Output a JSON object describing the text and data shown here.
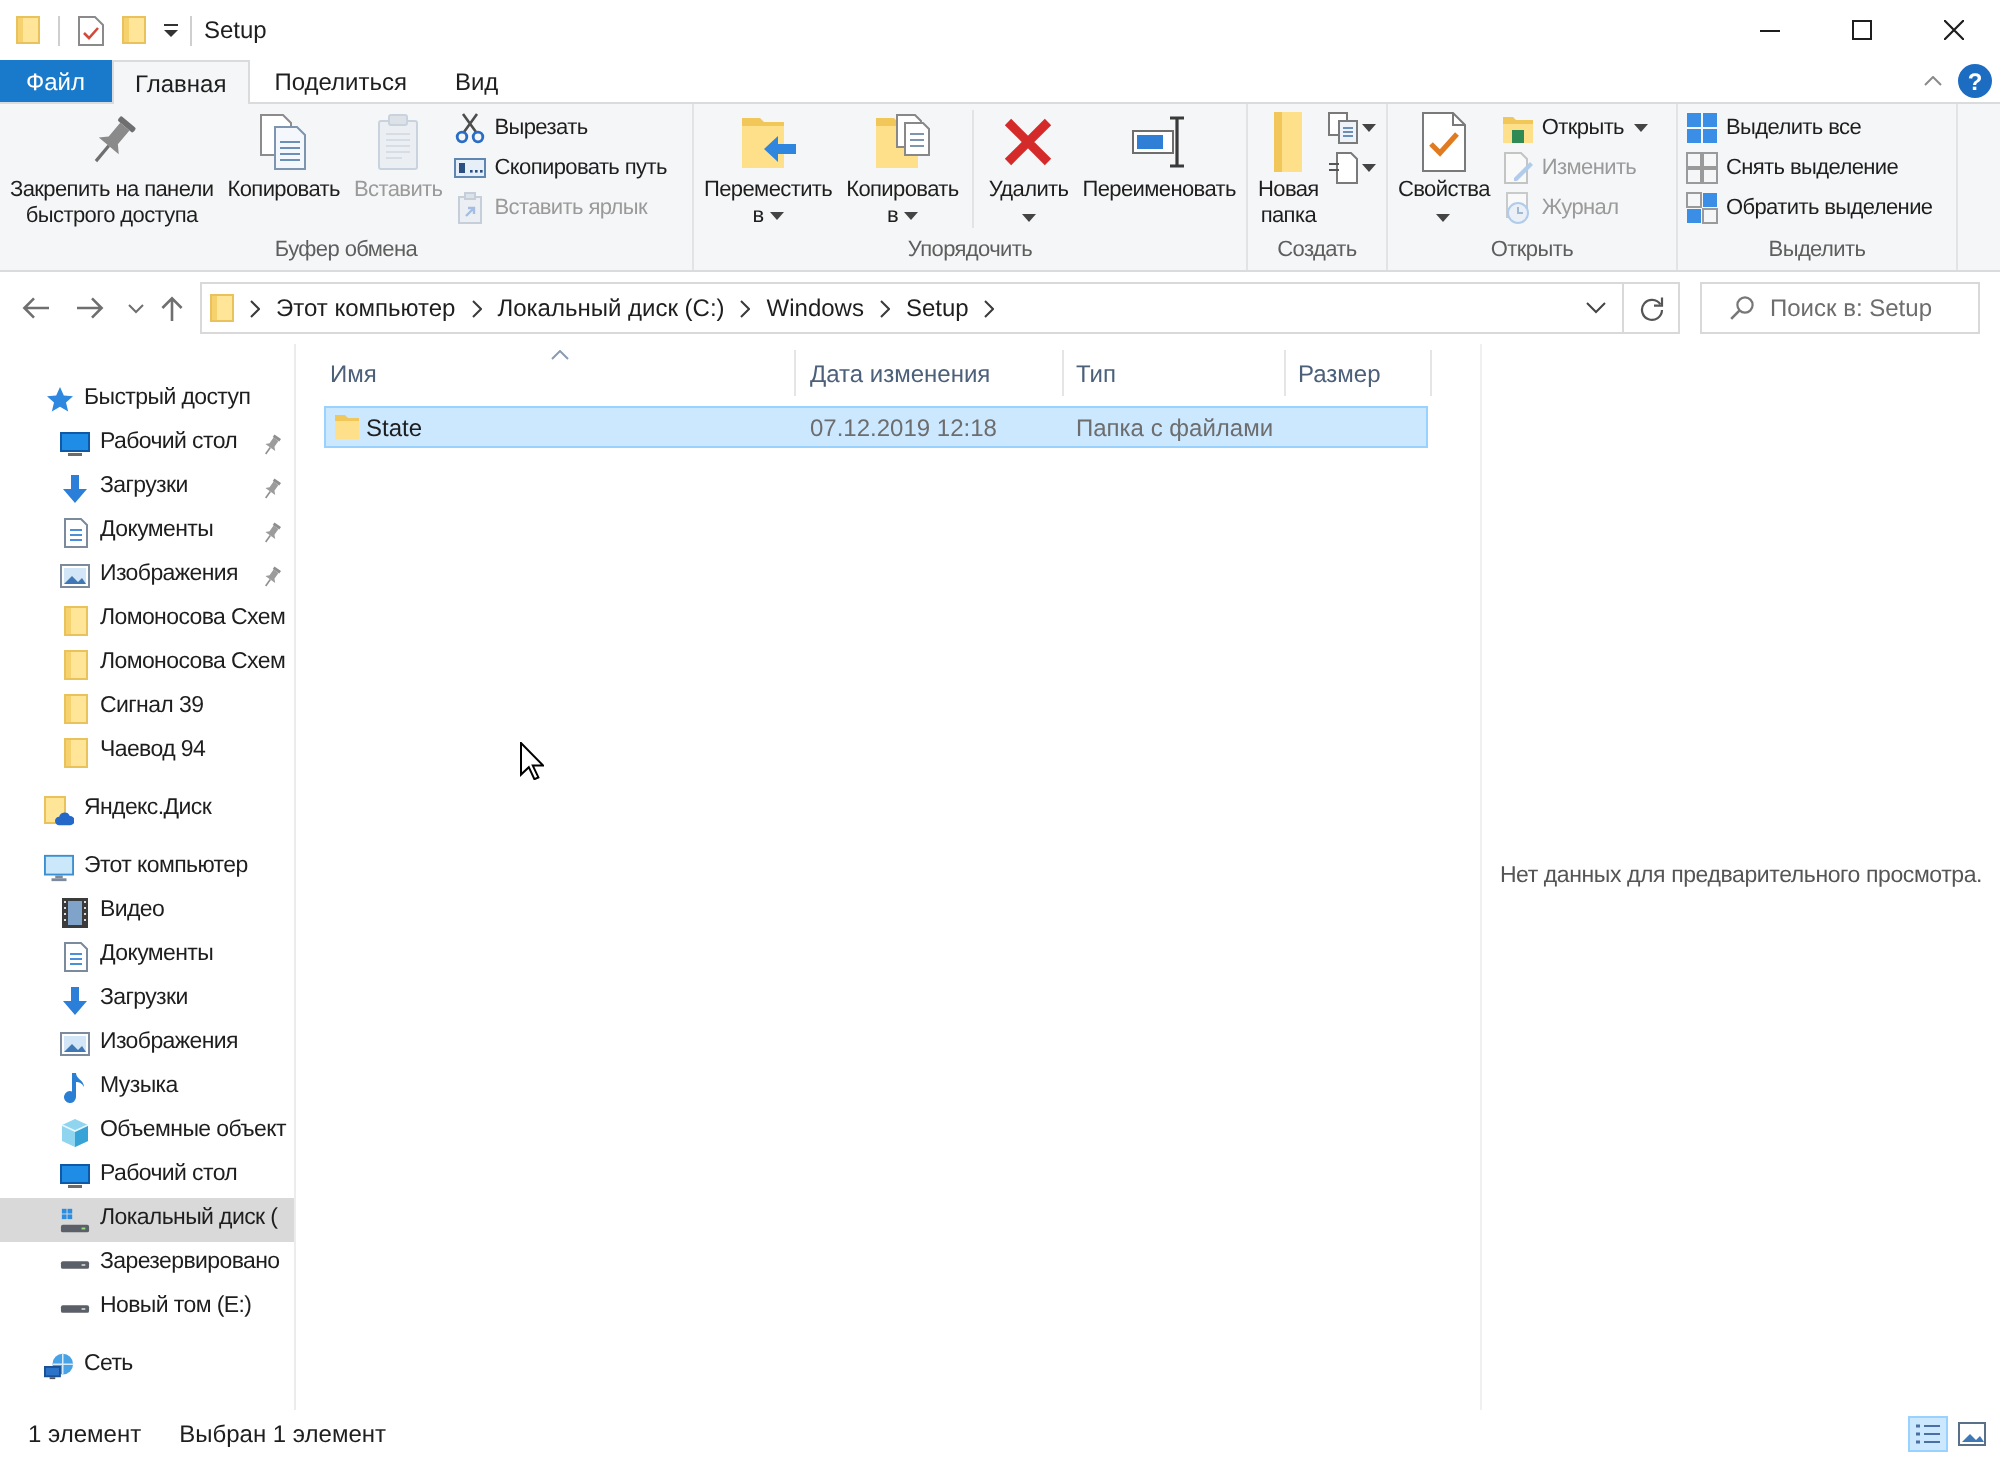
{
  "window": {
    "title": "Setup"
  },
  "ribbon": {
    "tabs": [
      {
        "label": "Файл",
        "kind": "file",
        "selected": false
      },
      {
        "label": "Главная",
        "kind": "tab",
        "selected": true
      },
      {
        "label": "Поделиться",
        "kind": "tab",
        "selected": false
      },
      {
        "label": "Вид",
        "kind": "tab",
        "selected": false
      }
    ],
    "help": "?",
    "groups": [
      {
        "label": "Буфер обмена",
        "commands": [
          {
            "kind": "large",
            "label": "Закрепить на панели\nбыстрого доступа",
            "disabled": false,
            "dropdown": false
          },
          {
            "kind": "large",
            "label": "Копировать",
            "disabled": false,
            "dropdown": false
          },
          {
            "kind": "large",
            "label": "Вставить",
            "disabled": true,
            "dropdown": false
          },
          {
            "kind": "small",
            "label": "Вырезать",
            "disabled": false,
            "dropdown": false
          },
          {
            "kind": "small",
            "label": "Скопировать путь",
            "disabled": false,
            "dropdown": false
          },
          {
            "kind": "small",
            "label": "Вставить ярлык",
            "disabled": true,
            "dropdown": false
          }
        ]
      },
      {
        "label": "Упорядочить",
        "commands": [
          {
            "kind": "large",
            "label": "Переместить\nв",
            "disabled": false,
            "dropdown": true
          },
          {
            "kind": "large",
            "label": "Копировать\nв",
            "disabled": false,
            "dropdown": true
          },
          {
            "kind": "separator"
          },
          {
            "kind": "large",
            "label": "Удалить",
            "disabled": false,
            "dropdown": true
          },
          {
            "kind": "large",
            "label": "Переименовать",
            "disabled": false,
            "dropdown": false
          }
        ]
      },
      {
        "label": "Создать",
        "commands": [
          {
            "kind": "large",
            "label": "Новая\nпапка",
            "disabled": false,
            "dropdown": false
          },
          {
            "kind": "icon",
            "disabled": false,
            "dropdown": true
          },
          {
            "kind": "icon",
            "disabled": false,
            "dropdown": true
          }
        ]
      },
      {
        "label": "Открыть",
        "commands": [
          {
            "kind": "large",
            "label": "Свойства",
            "disabled": false,
            "dropdown": true
          },
          {
            "kind": "small",
            "label": "Открыть",
            "disabled": false,
            "dropdown": true
          },
          {
            "kind": "small",
            "label": "Изменить",
            "disabled": true,
            "dropdown": false
          },
          {
            "kind": "small",
            "label": "Журнал",
            "disabled": true,
            "dropdown": false
          }
        ]
      },
      {
        "label": "Выделить",
        "commands": [
          {
            "kind": "small",
            "label": "Выделить все",
            "disabled": false,
            "dropdown": false
          },
          {
            "kind": "small",
            "label": "Снять выделение",
            "disabled": false,
            "dropdown": false
          },
          {
            "kind": "small",
            "label": "Обратить выделение",
            "disabled": false,
            "dropdown": false
          }
        ]
      }
    ]
  },
  "address_bar": {
    "crumbs": [
      "Этот компьютер",
      "Локальный диск (C:)",
      "Windows",
      "Setup"
    ]
  },
  "search": {
    "placeholder": "Поиск в: Setup"
  },
  "navigation": [
    {
      "label": "Быстрый доступ",
      "kind": "quickaccess",
      "selected": false,
      "children": [
        {
          "label": "Рабочий стол",
          "kind": "desktop",
          "selected": false,
          "pinned": true
        },
        {
          "label": "Загрузки",
          "kind": "downloads",
          "selected": false,
          "pinned": true
        },
        {
          "label": "Документы",
          "kind": "documents",
          "selected": false,
          "pinned": true
        },
        {
          "label": "Изображения",
          "kind": "pictures",
          "selected": false,
          "pinned": true
        },
        {
          "label": "Ломоносова Схем",
          "kind": "folder",
          "selected": false,
          "pinned": false
        },
        {
          "label": "Ломоносова Схем",
          "kind": "folder",
          "selected": false,
          "pinned": false
        },
        {
          "label": "Сигнал 39",
          "kind": "folder",
          "selected": false,
          "pinned": false
        },
        {
          "label": "Чаевод 94",
          "kind": "folder",
          "selected": false,
          "pinned": false
        }
      ]
    },
    {
      "label": "Яндекс.Диск",
      "kind": "cloud",
      "selected": false
    },
    {
      "label": "Этот компьютер",
      "kind": "computer",
      "selected": false,
      "children": [
        {
          "label": "Видео",
          "kind": "videos",
          "selected": false
        },
        {
          "label": "Документы",
          "kind": "documents",
          "selected": false
        },
        {
          "label": "Загрузки",
          "kind": "downloads",
          "selected": false
        },
        {
          "label": "Изображения",
          "kind": "pictures",
          "selected": false
        },
        {
          "label": "Музыка",
          "kind": "music",
          "selected": false
        },
        {
          "label": "Объемные объект",
          "kind": "objects",
          "selected": false
        },
        {
          "label": "Рабочий стол",
          "kind": "desktop",
          "selected": false
        },
        {
          "label": "Локальный диск (",
          "kind": "systemdrive",
          "selected": true
        },
        {
          "label": "Зарезервировано",
          "kind": "drive",
          "selected": false
        },
        {
          "label": "Новый том (E:)",
          "kind": "drive",
          "selected": false
        }
      ]
    },
    {
      "label": "Сеть",
      "kind": "network",
      "selected": false
    }
  ],
  "file_list": {
    "columns": [
      {
        "label": "Имя",
        "sorted": true
      },
      {
        "label": "Дата изменения",
        "sorted": false
      },
      {
        "label": "Тип",
        "sorted": false
      },
      {
        "label": "Размер",
        "sorted": false
      }
    ],
    "rows": [
      {
        "name": "State",
        "date": "07.12.2019 12:18",
        "type": "Папка с файлами",
        "selected": true
      }
    ]
  },
  "preview": {
    "message": "Нет данных для предварительного просмотра."
  },
  "status_bar": {
    "item_count": "1 элемент",
    "selection": "Выбран 1 элемент",
    "views": [
      {
        "kind": "details",
        "selected": true
      },
      {
        "kind": "thumbnails",
        "selected": false
      }
    ]
  }
}
